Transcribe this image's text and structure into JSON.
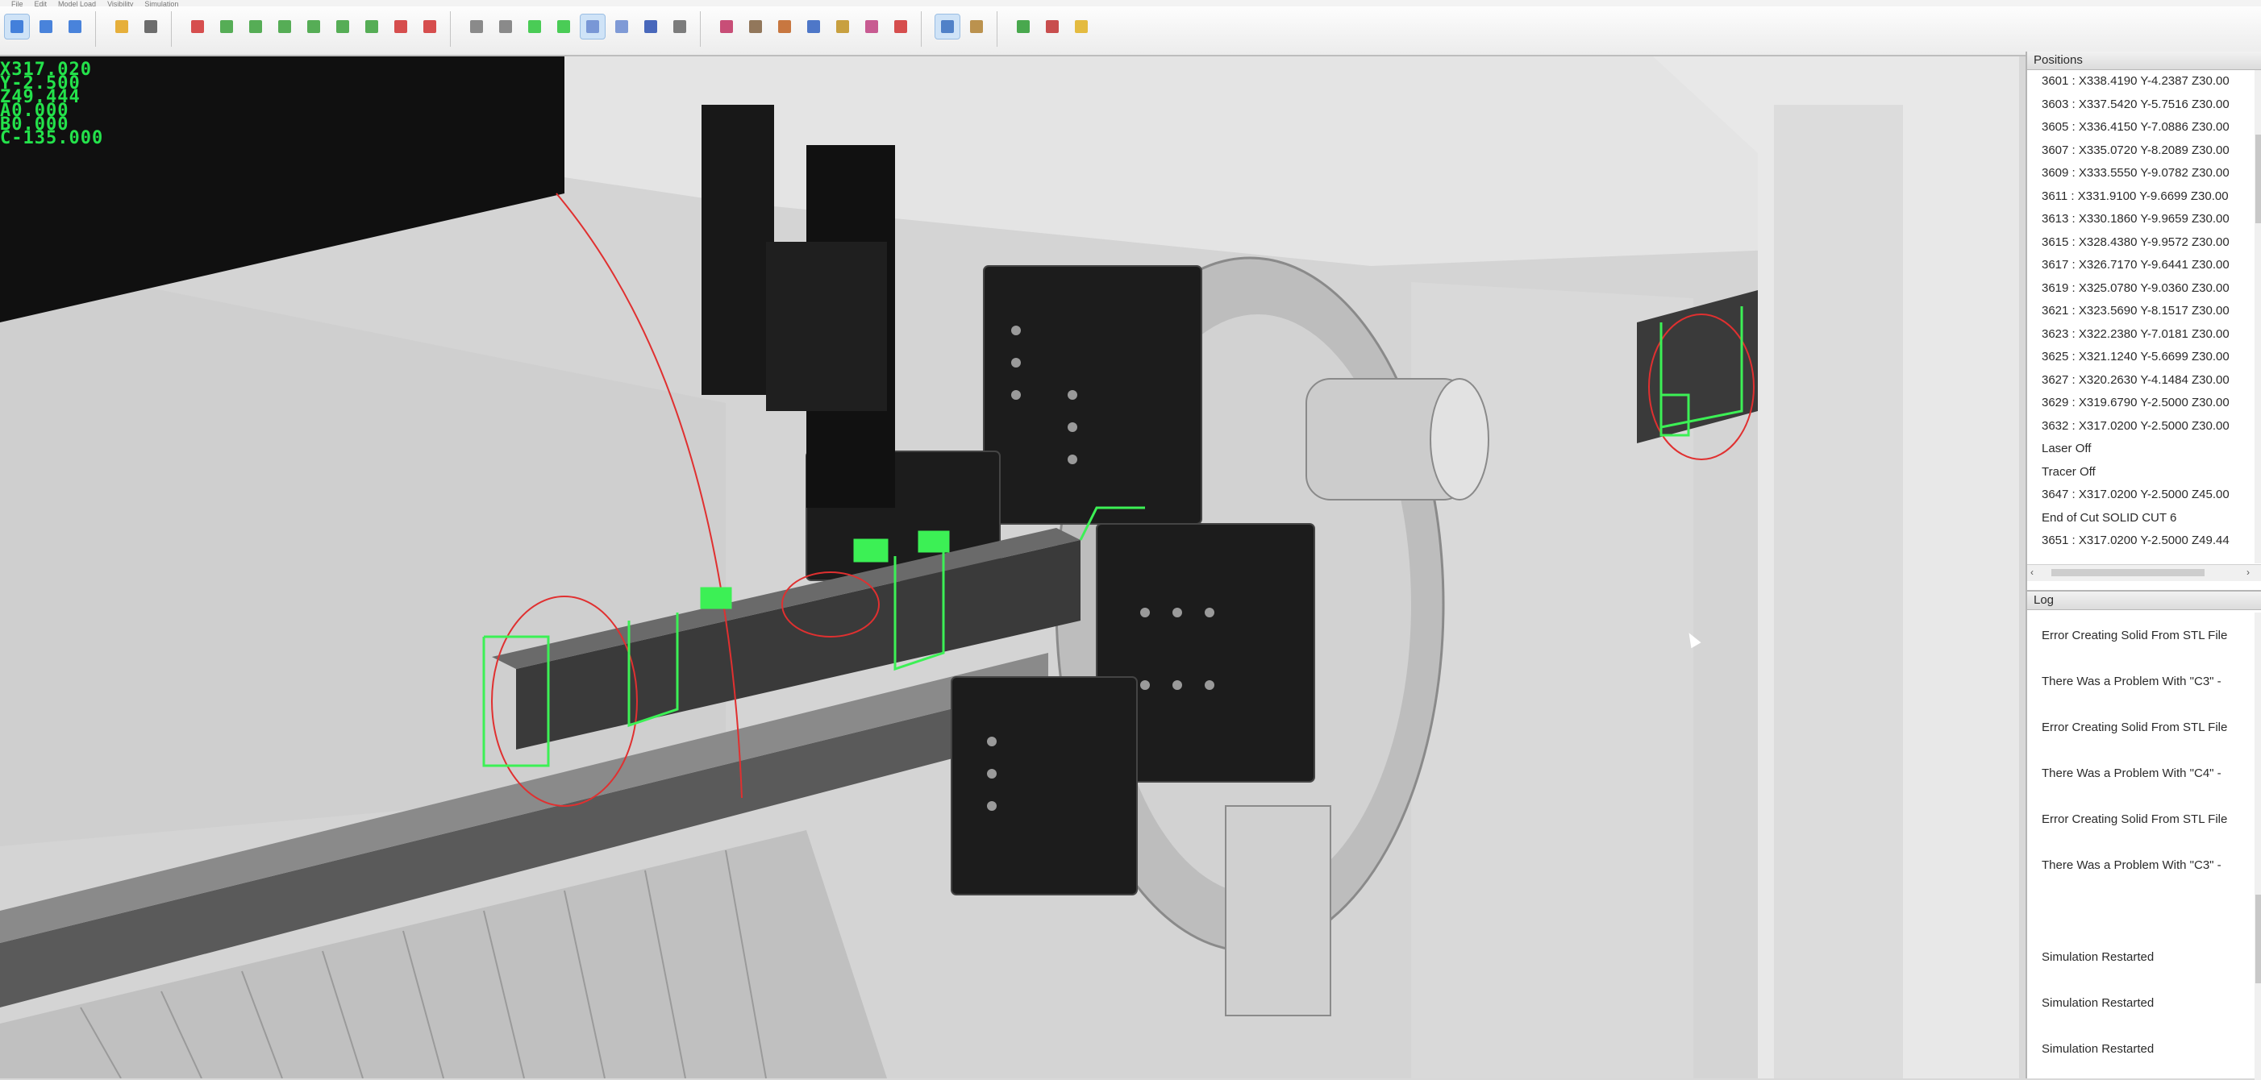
{
  "menubar": {
    "items": [
      "File",
      "Edit",
      "Model Load",
      "Visibility",
      "Simulation"
    ]
  },
  "toolbar": {
    "buttons": [
      {
        "icon": "select-frame-icon"
      },
      {
        "icon": "zoom-extents-icon"
      },
      {
        "icon": "view-fit-icon"
      },
      {
        "icon": "pointer-icon"
      },
      {
        "icon": "pan-hand-icon"
      },
      {
        "icon": "axis-triad-icon"
      },
      {
        "icon": "view-iso-icon"
      },
      {
        "icon": "view-front-icon"
      },
      {
        "icon": "view-side-icon"
      },
      {
        "icon": "view-top-icon"
      },
      {
        "icon": "view-bottom-icon"
      },
      {
        "icon": "view-back-icon"
      },
      {
        "icon": "toggle-part-icon"
      },
      {
        "icon": "toggle-path-icon"
      },
      {
        "icon": "wireframe-icon"
      },
      {
        "icon": "hidden-line-icon"
      },
      {
        "icon": "shaded-icon"
      },
      {
        "icon": "shaded-edges-icon"
      },
      {
        "icon": "transparent-icon"
      },
      {
        "icon": "outline-icon"
      },
      {
        "icon": "material-icon"
      },
      {
        "icon": "stock-icon"
      },
      {
        "icon": "sim-start-icon"
      },
      {
        "icon": "sim-step-icon"
      },
      {
        "icon": "sim-pause-icon"
      },
      {
        "icon": "sim-run-icon"
      },
      {
        "icon": "sim-fast-icon"
      },
      {
        "icon": "sim-reverse-icon"
      },
      {
        "icon": "sim-stop-icon"
      },
      {
        "icon": "pencil-icon"
      },
      {
        "icon": "measure-icon"
      },
      {
        "icon": "collision-icon"
      },
      {
        "icon": "tree-icon"
      },
      {
        "icon": "settings-icon"
      }
    ]
  },
  "dro": {
    "lines": [
      "X317.020",
      "Y-2.500",
      "Z49.444",
      "A0.000",
      "B0.000",
      "C-135.000"
    ]
  },
  "positions": {
    "title": "Positions",
    "rows": [
      "3601 :  X338.4190 Y-4.2387 Z30.00",
      "3603 :  X337.5420 Y-5.7516 Z30.00",
      "3605 :  X336.4150 Y-7.0886 Z30.00",
      "3607 :  X335.0720 Y-8.2089 Z30.00",
      "3609 :  X333.5550 Y-9.0782 Z30.00",
      "3611 :  X331.9100 Y-9.6699 Z30.00",
      "3613 :  X330.1860 Y-9.9659 Z30.00",
      "3615 :  X328.4380 Y-9.9572 Z30.00",
      "3617 :  X326.7170 Y-9.6441 Z30.00",
      "3619 :  X325.0780 Y-9.0360 Z30.00",
      "3621 :  X323.5690 Y-8.1517 Z30.00",
      "3623 :  X322.2380 Y-7.0181 Z30.00",
      "3625 :  X321.1240 Y-5.6699 Z30.00",
      "3627 :  X320.2630 Y-4.1484 Z30.00",
      "3629 :  X319.6790 Y-2.5000 Z30.00",
      "3632 :  X317.0200 Y-2.5000 Z30.00",
      "Laser Off",
      "Tracer Off",
      "3647 :  X317.0200 Y-2.5000 Z45.00",
      "End of Cut SOLID CUT 6",
      "3651 :  X317.0200 Y-2.5000 Z49.44"
    ]
  },
  "log": {
    "title": "Log",
    "rows": [
      "Error Creating Solid From STL File",
      "There Was a Problem With \"C3\" -",
      "Error Creating Solid From STL File",
      "There Was a Problem With \"C4\" -",
      "Error Creating Solid From STL File",
      "There Was a Problem With \"C3\" -",
      "",
      "Simulation Restarted",
      "Simulation Restarted",
      "Simulation Restarted"
    ]
  },
  "colors": {
    "dro_text": "#24e24b",
    "toolpath": "#3cf055",
    "arc": "#e03030",
    "machine_dark": "#1c1c1c",
    "machine_light": "#dcdcdc"
  }
}
